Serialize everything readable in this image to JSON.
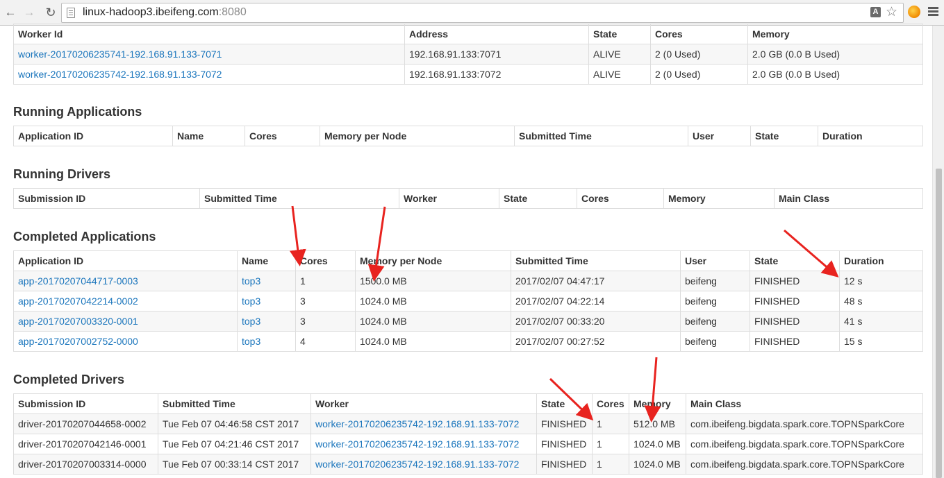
{
  "browser": {
    "url_host": "linux-hadoop3.ibeifeng.com",
    "url_port": ":8080"
  },
  "workers": {
    "headers": [
      "Worker Id",
      "Address",
      "State",
      "Cores",
      "Memory"
    ],
    "rows": [
      {
        "id": "worker-20170206235741-192.168.91.133-7071",
        "address": "192.168.91.133:7071",
        "state": "ALIVE",
        "cores": "2 (0 Used)",
        "memory": "2.0 GB (0.0 B Used)"
      },
      {
        "id": "worker-20170206235742-192.168.91.133-7072",
        "address": "192.168.91.133:7072",
        "state": "ALIVE",
        "cores": "2 (0 Used)",
        "memory": "2.0 GB (0.0 B Used)"
      }
    ]
  },
  "running_applications": {
    "title": "Running Applications",
    "headers": [
      "Application ID",
      "Name",
      "Cores",
      "Memory per Node",
      "Submitted Time",
      "User",
      "State",
      "Duration"
    ]
  },
  "running_drivers": {
    "title": "Running Drivers",
    "headers": [
      "Submission ID",
      "Submitted Time",
      "Worker",
      "State",
      "Cores",
      "Memory",
      "Main Class"
    ]
  },
  "completed_applications": {
    "title": "Completed Applications",
    "headers": [
      "Application ID",
      "Name",
      "Cores",
      "Memory per Node",
      "Submitted Time",
      "User",
      "State",
      "Duration"
    ],
    "rows": [
      {
        "id": "app-20170207044717-0003",
        "name": "top3",
        "cores": "1",
        "memory": "1500.0 MB",
        "submitted": "2017/02/07 04:47:17",
        "user": "beifeng",
        "state": "FINISHED",
        "duration": "12 s"
      },
      {
        "id": "app-20170207042214-0002",
        "name": "top3",
        "cores": "3",
        "memory": "1024.0 MB",
        "submitted": "2017/02/07 04:22:14",
        "user": "beifeng",
        "state": "FINISHED",
        "duration": "48 s"
      },
      {
        "id": "app-20170207003320-0001",
        "name": "top3",
        "cores": "3",
        "memory": "1024.0 MB",
        "submitted": "2017/02/07 00:33:20",
        "user": "beifeng",
        "state": "FINISHED",
        "duration": "41 s"
      },
      {
        "id": "app-20170207002752-0000",
        "name": "top3",
        "cores": "4",
        "memory": "1024.0 MB",
        "submitted": "2017/02/07 00:27:52",
        "user": "beifeng",
        "state": "FINISHED",
        "duration": "15 s"
      }
    ]
  },
  "completed_drivers": {
    "title": "Completed Drivers",
    "headers": [
      "Submission ID",
      "Submitted Time",
      "Worker",
      "State",
      "Cores",
      "Memory",
      "Main Class"
    ],
    "rows": [
      {
        "id": "driver-20170207044658-0002",
        "submitted": "Tue Feb 07 04:46:58 CST 2017",
        "worker": "worker-20170206235742-192.168.91.133-7072",
        "state": "FINISHED",
        "cores": "1",
        "memory": "512.0 MB",
        "main_class": "com.ibeifeng.bigdata.spark.core.TOPNSparkCore"
      },
      {
        "id": "driver-20170207042146-0001",
        "submitted": "Tue Feb 07 04:21:46 CST 2017",
        "worker": "worker-20170206235742-192.168.91.133-7072",
        "state": "FINISHED",
        "cores": "1",
        "memory": "1024.0 MB",
        "main_class": "com.ibeifeng.bigdata.spark.core.TOPNSparkCore"
      },
      {
        "id": "driver-20170207003314-0000",
        "submitted": "Tue Feb 07 00:33:14 CST 2017",
        "worker": "worker-20170206235742-192.168.91.133-7072",
        "state": "FINISHED",
        "cores": "1",
        "memory": "1024.0 MB",
        "main_class": "com.ibeifeng.bigdata.spark.core.TOPNSparkCore"
      }
    ]
  },
  "colors": {
    "link": "#1a75bc",
    "annotation_arrow": "#e8231f"
  }
}
